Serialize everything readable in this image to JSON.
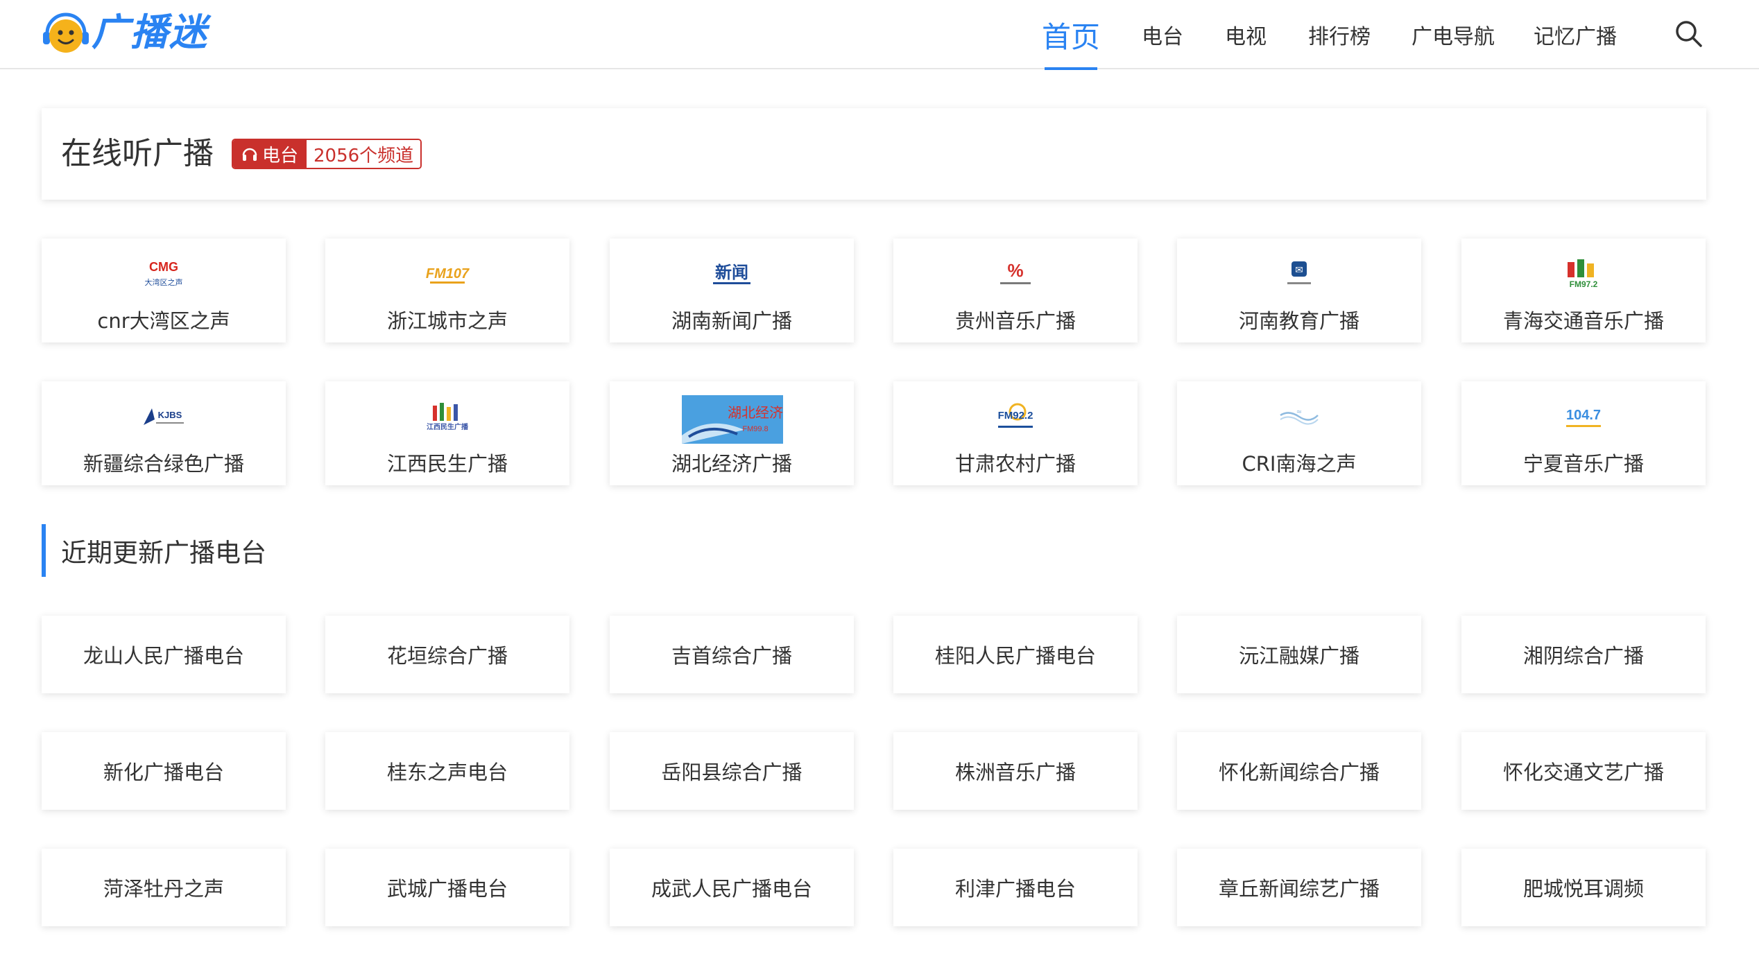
{
  "header": {
    "logo_text": "广播迷",
    "nav": [
      {
        "label": "首页",
        "active": true
      },
      {
        "label": "电台",
        "active": false
      },
      {
        "label": "电视",
        "active": false
      },
      {
        "label": "排行榜",
        "active": false
      },
      {
        "label": "广电导航",
        "active": false
      },
      {
        "label": "记忆广播",
        "active": false
      }
    ],
    "search_icon": "search-icon"
  },
  "hero": {
    "title": "在线听广播",
    "badge_label": "电台",
    "badge_count": "2056个频道",
    "badge_icon": "headphones-icon"
  },
  "featured": [
    {
      "name": "cnr大湾区之声",
      "logo_text": "CMG",
      "logo_sub": "大湾区之声",
      "color": "#d7261e"
    },
    {
      "name": "浙江城市之声",
      "logo_text": "FM107",
      "logo_sub": "",
      "color": "#e9a21c"
    },
    {
      "name": "湖南新闻广播",
      "logo_text": "新闻",
      "logo_sub": "",
      "color": "#1f4d9a"
    },
    {
      "name": "贵州音乐广播",
      "logo_text": "%",
      "logo_sub": "",
      "color": "#d6312c"
    },
    {
      "name": "河南教育广播",
      "logo_text": "✉",
      "logo_sub": "",
      "color": "#1d4f91"
    },
    {
      "name": "青海交通音乐广播",
      "logo_text": "FM97.2",
      "logo_sub": "",
      "color": "#2f8f3a"
    },
    {
      "name": "新疆综合绿色广播",
      "logo_text": "KJBS",
      "logo_sub": "",
      "color": "#1a3e8a"
    },
    {
      "name": "江西民生广播",
      "logo_text": "江西民生广播",
      "logo_sub": "",
      "color": "#3b56a8"
    },
    {
      "name": "湖北经济广播",
      "logo_text": "湖北经济",
      "logo_sub": "FM99.8",
      "color": "#4aa0e0"
    },
    {
      "name": "甘肃农村广播",
      "logo_text": "FM92.2",
      "logo_sub": "",
      "color": "#1c4f9c"
    },
    {
      "name": "CRI南海之声",
      "logo_text": "≈",
      "logo_sub": "",
      "color": "#8fbbe0"
    },
    {
      "name": "宁夏音乐广播",
      "logo_text": "104.7",
      "logo_sub": "",
      "color": "#3a8ee0"
    }
  ],
  "recent": {
    "title": "近期更新广播电台",
    "items": [
      "龙山人民广播电台",
      "花垣综合广播",
      "吉首综合广播",
      "桂阳人民广播电台",
      "沅江融媒广播",
      "湘阴综合广播",
      "新化广播电台",
      "桂东之声电台",
      "岳阳县综合广播",
      "株洲音乐广播",
      "怀化新闻综合广播",
      "怀化交通文艺广播",
      "菏泽牡丹之声",
      "武城广播电台",
      "成武人民广播电台",
      "利津广播电台",
      "章丘新闻综艺广播",
      "肥城悦耳调频"
    ]
  }
}
